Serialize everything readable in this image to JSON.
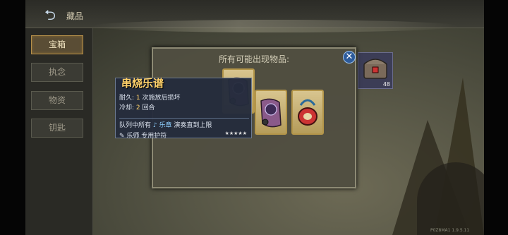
{
  "header": {
    "title": "藏品"
  },
  "sidebar": {
    "items": [
      {
        "label": "宝箱",
        "active": true
      },
      {
        "label": "执念",
        "active": false
      },
      {
        "label": "物资",
        "active": false
      },
      {
        "label": "钥匙",
        "active": false
      }
    ]
  },
  "dialog": {
    "title": "所有可能出现物品:"
  },
  "tooltip": {
    "name": "串烧乐谱",
    "durability_label": "耐久:",
    "durability_value": "1",
    "durability_suffix": "次施放后损坏",
    "cooldown_label": "冷却:",
    "cooldown_value": "2",
    "cooldown_suffix": "回合",
    "effect_prefix": "队列中所有",
    "effect_highlight": "乐章",
    "effect_suffix": "演奏直到上限",
    "tag": "乐师 专用护符",
    "stars": "★★★★★"
  },
  "reward": {
    "count": "48"
  },
  "footer": {
    "text": "P0Z8MA1 1.9.5.11"
  },
  "colors": {
    "accent": "#ffd16a",
    "close": "#2d5b9b",
    "card_border": "#b39549"
  }
}
